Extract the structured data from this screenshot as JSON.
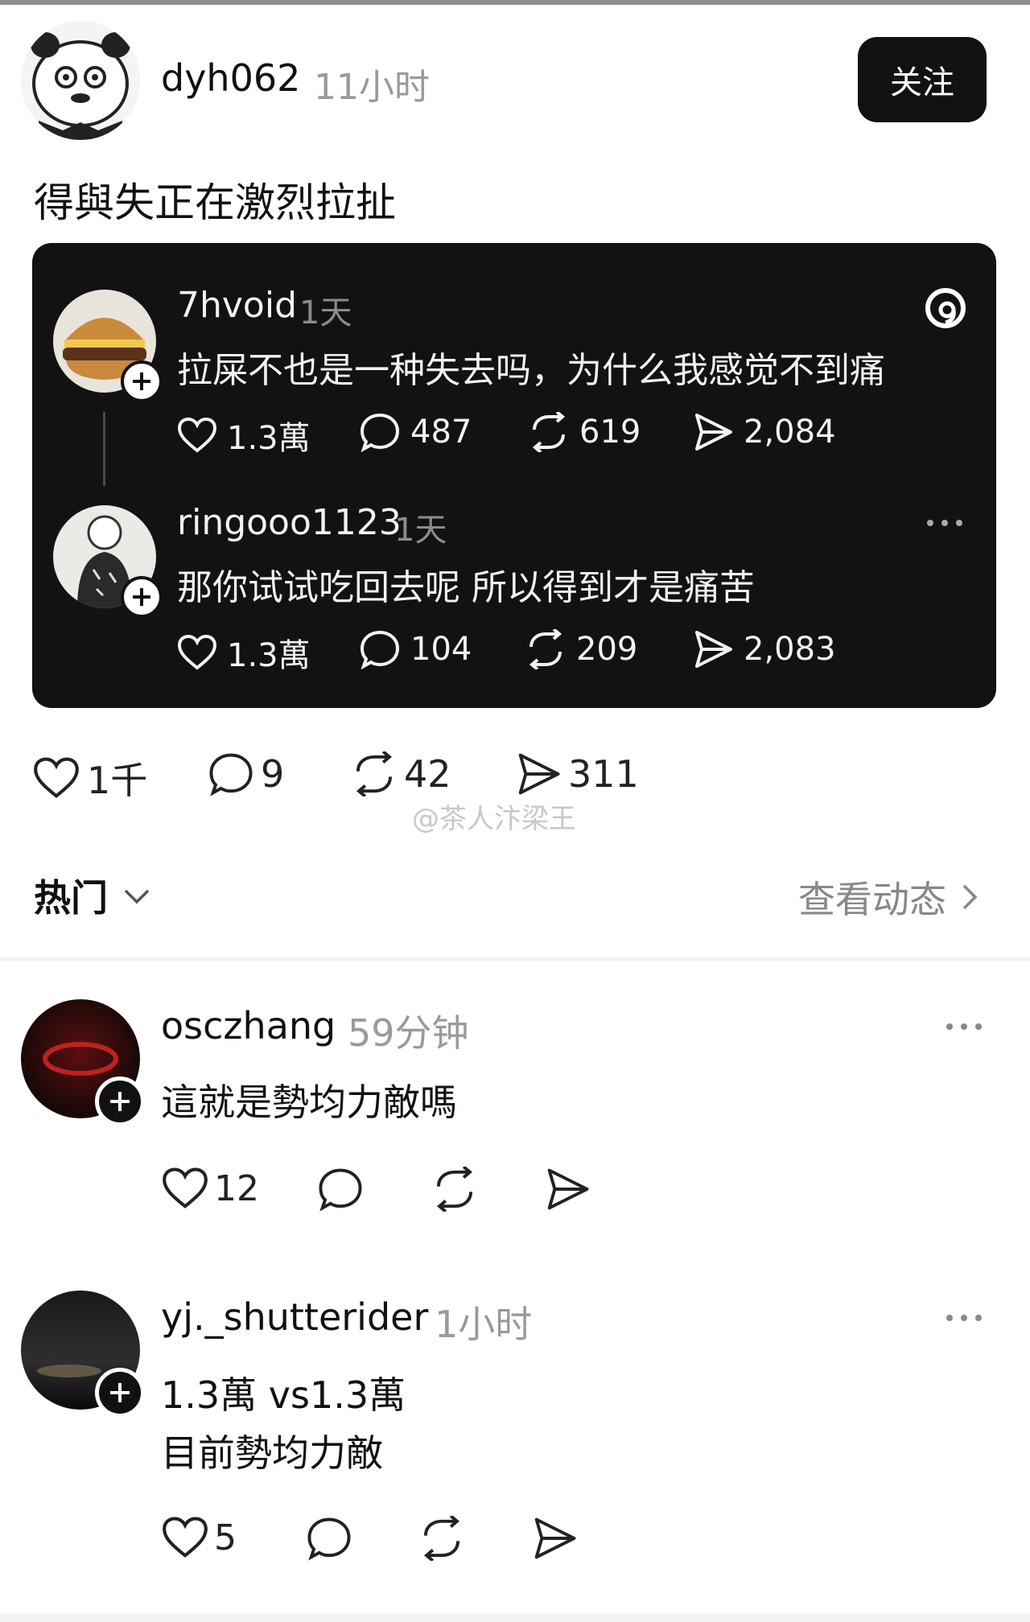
{
  "post": {
    "username": "dyh062",
    "time": "11小时",
    "follow_label": "关注",
    "text": "得與失正在激烈拉扯",
    "likes": "1千",
    "comments": "9",
    "reposts": "42",
    "shares": "311"
  },
  "quoted": [
    {
      "username": "7hvoid",
      "time": "1天",
      "text": "拉屎不也是一种失去吗，为什么我感觉不到痛",
      "likes": "1.3萬",
      "comments": "487",
      "reposts": "619",
      "shares": "2,084"
    },
    {
      "username": "ringooo1123",
      "time": "1天",
      "text": "那你试试吃回去呢 所以得到才是痛苦",
      "likes": "1.3萬",
      "comments": "104",
      "reposts": "209",
      "shares": "2,083"
    }
  ],
  "watermark": "@茶人汴梁王",
  "sort": {
    "label": "热门"
  },
  "activity_label": "查看动态",
  "replies": [
    {
      "username": "osczhang",
      "time": "59分钟",
      "lines": [
        "這就是勢均力敵嗎"
      ],
      "likes": "12"
    },
    {
      "username": "yj._shutterider",
      "time": "1小时",
      "lines": [
        "1.3萬 vs1.3萬",
        "目前勢均力敵"
      ],
      "likes": "5"
    }
  ],
  "icons": {
    "like": "heart-icon",
    "comment": "comment-icon",
    "repost": "repost-icon",
    "share": "share-icon",
    "brand": "threads-logo-icon"
  },
  "colors": {
    "card_bg": "#121212",
    "follow_bg": "#111111",
    "muted": "#9a9a9a"
  }
}
